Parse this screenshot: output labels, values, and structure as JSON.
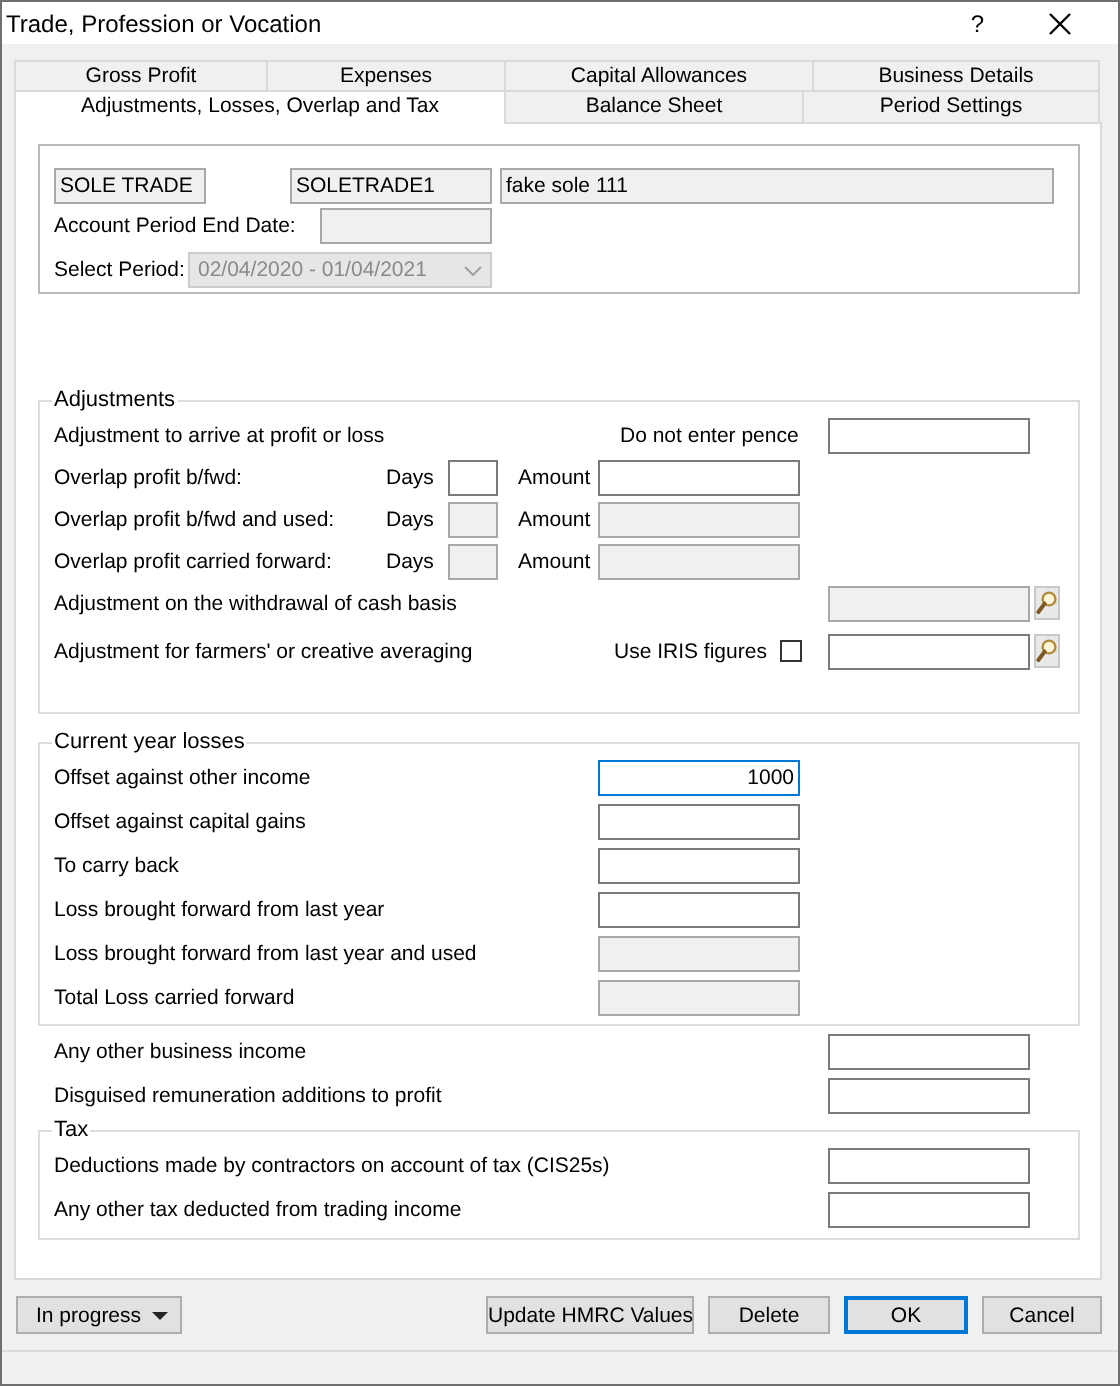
{
  "window": {
    "title": "Trade, Profession or Vocation",
    "help": "?"
  },
  "tabs": [
    [
      {
        "label": "Gross Profit",
        "selected": false
      },
      {
        "label": "Expenses",
        "selected": false
      },
      {
        "label": "Capital Allowances",
        "selected": false
      },
      {
        "label": "Business Details",
        "selected": false
      }
    ],
    [
      {
        "label": "Adjustments, Losses, Overlap and Tax",
        "selected": true
      },
      {
        "label": "Balance Sheet",
        "selected": false
      },
      {
        "label": "Period Settings",
        "selected": false
      }
    ]
  ],
  "header": {
    "code": {
      "value": "SOLE TRADE",
      "disabled": true
    },
    "reference": {
      "value": "SOLETRADE1",
      "disabled": true
    },
    "name": {
      "value": "fake sole 111",
      "disabled": true
    },
    "end_date_label": "Account Period End Date:",
    "end_date": {
      "disabled": true
    },
    "period_label": "Select Period:",
    "period": {
      "value": "02/04/2020 - 01/04/2021",
      "disabled": true
    }
  },
  "adjustments": {
    "title": "Adjustments",
    "rows": [
      {
        "kind": "note",
        "label": "Adjustment to arrive at profit or loss",
        "note": "Do not enter pence",
        "field": {
          "disabled": false
        }
      },
      {
        "kind": "overlap",
        "label": "Overlap profit b/fwd:",
        "days_label": "Days",
        "days": {
          "disabled": false
        },
        "amount_label": "Amount",
        "amount": {
          "disabled": false
        }
      },
      {
        "kind": "overlap",
        "label": "Overlap profit b/fwd and used:",
        "days_label": "Days",
        "days": {
          "disabled": true
        },
        "amount_label": "Amount",
        "amount": {
          "disabled": true
        }
      },
      {
        "kind": "overlap",
        "label": "Overlap profit carried forward:",
        "days_label": "Days",
        "days": {
          "disabled": true
        },
        "amount_label": "Amount",
        "amount": {
          "disabled": true
        }
      },
      {
        "kind": "lookup",
        "label": "Adjustment on the withdrawal of cash basis",
        "field": {
          "disabled": true
        }
      },
      {
        "kind": "lookup",
        "label": "Adjustment for farmers' or creative averaging",
        "option": {
          "label": "Use IRIS figures",
          "checked": false
        },
        "field": {
          "disabled": false
        }
      }
    ]
  },
  "losses": {
    "title": "Current year losses",
    "rows": [
      {
        "label": "Offset against other income",
        "field": {
          "value": "1000",
          "disabled": false,
          "focused": true
        }
      },
      {
        "label": "Offset against capital gains",
        "field": {
          "disabled": false,
          "focused": false
        }
      },
      {
        "label": "To carry back",
        "field": {
          "disabled": false,
          "focused": false
        }
      },
      {
        "label": "Loss brought forward from last year",
        "field": {
          "disabled": false,
          "focused": false
        }
      },
      {
        "label": "Loss brought forward from last year and used",
        "field": {
          "disabled": true,
          "focused": false
        }
      },
      {
        "label": "Total Loss carried forward",
        "field": {
          "disabled": true,
          "focused": false
        }
      }
    ]
  },
  "other_rows": [
    {
      "label": "Any other business income",
      "field": {
        "disabled": false
      }
    },
    {
      "label": "Disguised remuneration additions to profit",
      "field": {
        "disabled": false
      }
    }
  ],
  "tax": {
    "title": "Tax",
    "rows": [
      {
        "label": "Deductions made by contractors on account of tax (CIS25s)",
        "field": {
          "disabled": false
        }
      },
      {
        "label": "Any other tax deducted from trading income",
        "field": {
          "disabled": false
        }
      }
    ]
  },
  "footer": {
    "status": "In progress",
    "buttons": [
      {
        "label": "Update HMRC Values",
        "default": false
      },
      {
        "label": "Delete",
        "default": false
      },
      {
        "label": "OK",
        "default": true
      },
      {
        "label": "Cancel",
        "default": false
      }
    ]
  }
}
